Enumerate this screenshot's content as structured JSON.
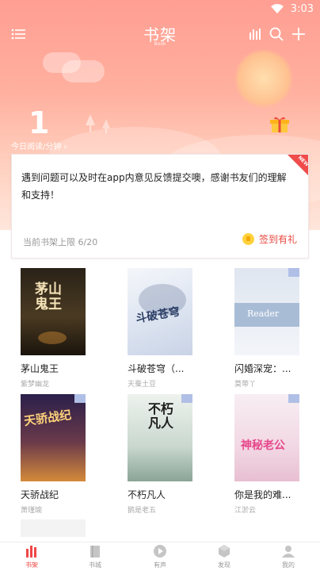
{
  "status_bar": {
    "time": "3:03"
  },
  "header": {
    "title": "书架",
    "subtitle": "Book",
    "read_minutes": "1",
    "read_label": "今日阅读/分钟 ›"
  },
  "notice": {
    "text": "遇到问题可以及时在app内意见反馈提交噢，感谢书友们的理解和支持！",
    "ribbon": "NEW",
    "shelf_limit": "当前书架上限 6/20",
    "sign_label": "签到有礼"
  },
  "books": [
    {
      "title": "茅山鬼王",
      "author": "紫梦幽龙",
      "cover_text": "茅山鬼王"
    },
    {
      "title": "斗破苍穹（...",
      "author": "天蚕土豆",
      "cover_text": "斗破苍穹"
    },
    {
      "title": "闪婚深宠：...",
      "author": "莫带丫",
      "cover_text": "Reader"
    },
    {
      "title": "天骄战纪",
      "author": "萧瑾瑜",
      "cover_text": "天骄战纪"
    },
    {
      "title": "不朽凡人",
      "author": "鹅是老五",
      "cover_text": "不朽凡人"
    },
    {
      "title": "你是我的难...",
      "author": "江淤云",
      "cover_text": "神秘老公"
    }
  ],
  "tabs": [
    {
      "label": "书架",
      "icon": "bookshelf-icon"
    },
    {
      "label": "书城",
      "icon": "bookstore-icon"
    },
    {
      "label": "有声",
      "icon": "audio-icon"
    },
    {
      "label": "发现",
      "icon": "discover-icon"
    },
    {
      "label": "我的",
      "icon": "profile-icon"
    }
  ],
  "colors": {
    "accent": "#ee4646",
    "header_top": "#ff9e93",
    "header_bottom": "#ffe6dc"
  }
}
